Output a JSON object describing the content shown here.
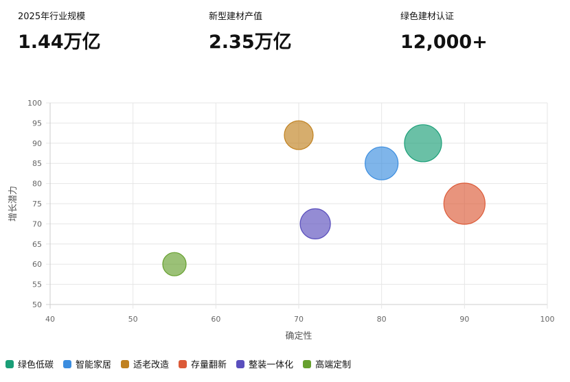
{
  "kpis": [
    {
      "label": "2025年行业规模",
      "value": "1.44万亿"
    },
    {
      "label": "新型建材产值",
      "value": "2.35万亿"
    },
    {
      "label": "绿色建材认证",
      "value": "12,000+"
    }
  ],
  "chart_data": {
    "type": "scatter",
    "xlabel": "确定性",
    "ylabel": "增长潜力",
    "xlim": [
      40,
      100
    ],
    "ylim": [
      50,
      100
    ],
    "xticks": [
      40,
      50,
      60,
      70,
      80,
      90,
      100
    ],
    "yticks": [
      50,
      55,
      60,
      65,
      70,
      75,
      80,
      85,
      90,
      95,
      100
    ],
    "grid": true,
    "legend_position": "bottom-left",
    "series": [
      {
        "name": "绿色低碳",
        "x": 85,
        "y": 90,
        "size": 27,
        "color": "#1a9e77"
      },
      {
        "name": "智能家居",
        "x": 80,
        "y": 85,
        "size": 24,
        "color": "#3b8ddf"
      },
      {
        "name": "适老改造",
        "x": 70,
        "y": 92,
        "size": 21,
        "color": "#c0811f"
      },
      {
        "name": "存量翻新",
        "x": 90,
        "y": 75,
        "size": 30,
        "color": "#dc5a38"
      },
      {
        "name": "整装一体化",
        "x": 72,
        "y": 70,
        "size": 22,
        "color": "#5a4fbd"
      },
      {
        "name": "高端定制",
        "x": 55,
        "y": 60,
        "size": 17,
        "color": "#66a02e"
      }
    ]
  }
}
